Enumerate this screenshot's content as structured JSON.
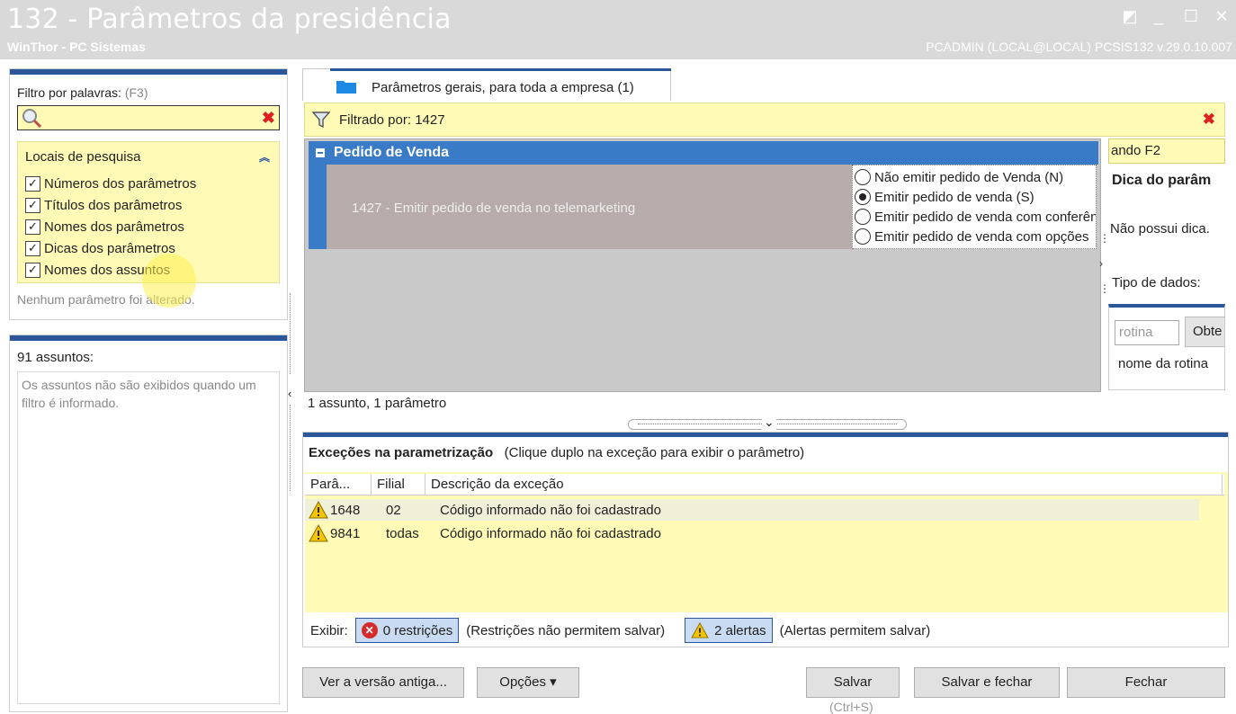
{
  "window": {
    "title": "132 - Parâmetros da presidência",
    "subtitle": "WinThor - PC Sistemas",
    "user_info": "PCADMIN (LOCAL@LOCAL)   PCSIS132  v.29.0.10.007",
    "controls": {
      "restore": "◩",
      "minimize": "_",
      "maximize": "☐",
      "close": "✕"
    }
  },
  "filter": {
    "label": "Filtro por palavras:",
    "shortcut": "(F3)",
    "value": "",
    "clear_icon": "✖"
  },
  "search_locations": {
    "title": "Locais de pesquisa",
    "collapse_icon": "︽",
    "items": [
      {
        "label": "Números dos parâmetros",
        "checked": true
      },
      {
        "label": "Títulos dos parâmetros",
        "checked": true
      },
      {
        "label": "Nomes dos parâmetros",
        "checked": true
      },
      {
        "label": "Dicas dos parâmetros",
        "checked": true
      },
      {
        "label": "Nomes dos assuntos",
        "checked": true
      }
    ],
    "status": "Nenhum parâmetro foi alterado."
  },
  "subjects": {
    "title": "91 assuntos:",
    "message": "Os assuntos não são exibidos quando um filtro é informado."
  },
  "tab": {
    "label": "Parâmetros gerais, para toda a empresa  (1)"
  },
  "filtered": {
    "label": "Filtrado por: 1427",
    "clear_icon": "✖"
  },
  "group": {
    "title": "Pedido de Venda",
    "param_label": "1427 - Emitir pedido de venda no telemarketing",
    "options": [
      {
        "label": "Não emitir pedido de Venda (N)",
        "selected": false
      },
      {
        "label": "Emitir pedido de venda  (S)",
        "selected": true
      },
      {
        "label": "Emitir pedido de venda com conferência",
        "selected": false
      },
      {
        "label": "Emitir pedido de venda com opções",
        "selected": false
      }
    ]
  },
  "param_count": "1 assunto, 1 parâmetro",
  "side": {
    "input_text": "ando F2",
    "tip_title": "Dica do parâm",
    "tip": "Não possui dica.",
    "data_type": "Tipo de dados:",
    "rot_placeholder": "rotina",
    "rot_button": "Obte",
    "rot_label": "nome da rotina"
  },
  "exceptions": {
    "title": "Exceções na parametrização",
    "hint": "(Clique duplo na exceção para exibir o parâmetro)",
    "columns": [
      "Parâ...",
      "Filial",
      "Descrição da exceção"
    ],
    "rows": [
      {
        "param": "1648",
        "filial": "02",
        "desc": "Código informado não foi cadastrado"
      },
      {
        "param": "9841",
        "filial": "todas",
        "desc": "Código informado não foi cadastrado"
      }
    ],
    "show_label": "Exibir:",
    "restrictions_button": "0 restrições",
    "restrictions_note": "(Restrições não permitem salvar)",
    "alerts_button": "2 alertas",
    "alerts_note": "(Alertas permitem salvar)"
  },
  "buttons": {
    "old_version": "Ver a versão antiga...",
    "options": "Opções ▾",
    "save": "Salvar",
    "save_close": "Salvar e fechar",
    "close": "Fechar",
    "save_shortcut": "(Ctrl+S)"
  },
  "colors": {
    "accent": "#2b579a",
    "highlight": "#fffbb7",
    "group_header": "#3a7bc8"
  }
}
